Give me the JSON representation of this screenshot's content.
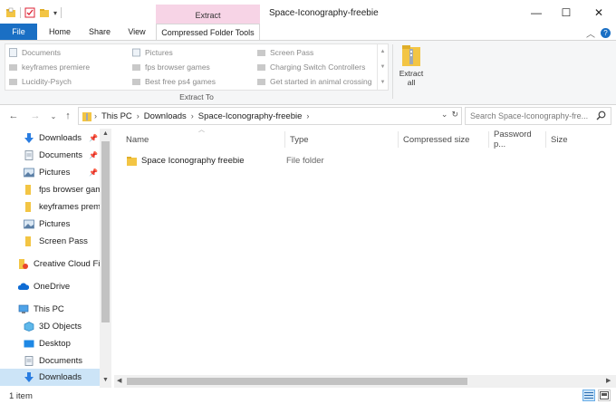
{
  "window": {
    "context_tab_header": "Extract",
    "title": "Space-Iconography-freebie",
    "controls": {
      "minimize": "—",
      "maximize": "☐",
      "close": "✕"
    }
  },
  "ribbon_tabs": [
    "File",
    "Home",
    "Share",
    "View",
    "Compressed Folder Tools"
  ],
  "ribbon": {
    "gallery": [
      {
        "label": "Documents",
        "icon": "documents-icon"
      },
      {
        "label": "keyframes premiere",
        "icon": "folder-icon"
      },
      {
        "label": "Lucidity-Psych",
        "icon": "folder-icon"
      },
      {
        "label": "Pictures",
        "icon": "pictures-icon"
      },
      {
        "label": "fps browser games",
        "icon": "folder-icon"
      },
      {
        "label": "Best free ps4 games",
        "icon": "folder-icon"
      },
      {
        "label": "Screen Pass",
        "icon": "folder-icon"
      },
      {
        "label": "Charging Switch Controllers",
        "icon": "folder-icon"
      },
      {
        "label": "Get started in animal crossing",
        "icon": "folder-icon"
      }
    ],
    "extract_all_label_1": "Extract",
    "extract_all_label_2": "all",
    "group_label": "Extract To"
  },
  "address_bar": {
    "crumbs": [
      "This PC",
      "Downloads",
      "Space-Iconography-freebie"
    ],
    "search_placeholder": "Search Space-Iconography-fre..."
  },
  "nav_pane": {
    "items": [
      {
        "label": "Downloads",
        "icon": "download-arrow-icon",
        "pinned": true
      },
      {
        "label": "Documents",
        "icon": "documents-icon",
        "pinned": true
      },
      {
        "label": "Pictures",
        "icon": "pictures-icon",
        "pinned": true
      },
      {
        "label": "fps browser gam",
        "icon": "folder-icon",
        "pinned": false
      },
      {
        "label": "keyframes premi",
        "icon": "folder-icon",
        "pinned": false
      },
      {
        "label": "Pictures",
        "icon": "pictures-icon",
        "pinned": false
      },
      {
        "label": "Screen Pass",
        "icon": "folder-icon",
        "pinned": false
      },
      {
        "label": "Creative Cloud File",
        "icon": "creative-cloud-icon",
        "pinned": false
      },
      {
        "label": "OneDrive",
        "icon": "onedrive-icon",
        "pinned": false
      },
      {
        "label": "This PC",
        "icon": "computer-icon",
        "pinned": false
      },
      {
        "label": "3D Objects",
        "icon": "3d-objects-icon",
        "pinned": false
      },
      {
        "label": "Desktop",
        "icon": "desktop-icon",
        "pinned": false
      },
      {
        "label": "Documents",
        "icon": "documents-icon",
        "pinned": false
      },
      {
        "label": "Downloads",
        "icon": "download-arrow-icon",
        "pinned": false,
        "selected": true
      }
    ]
  },
  "file_list": {
    "columns": [
      "Name",
      "Type",
      "Compressed size",
      "Password p...",
      "Size"
    ],
    "rows": [
      {
        "name": "Space Iconography freebie",
        "type": "File folder"
      }
    ]
  },
  "status_bar": {
    "item_count": "1 item"
  },
  "colors": {
    "accent": "#1a6fc4",
    "context_tab": "#f7d4e6",
    "selection": "#cce4f7",
    "folder": "#f3c544"
  }
}
